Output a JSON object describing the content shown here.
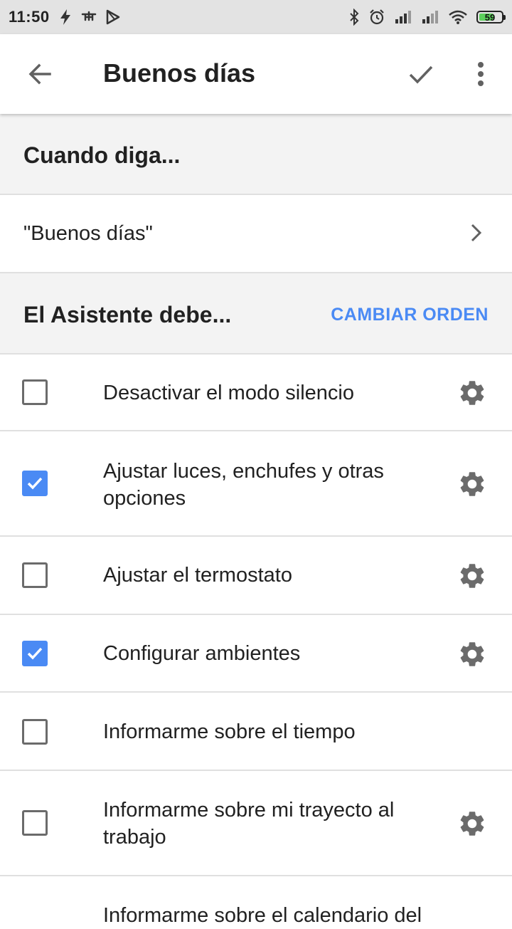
{
  "status_bar": {
    "time": "11:50",
    "battery": "59",
    "battery_color": "#5bd05b"
  },
  "app_bar": {
    "title": "Buenos días",
    "icons": [
      "back-arrow-icon",
      "check-icon",
      "more-vert-icon"
    ]
  },
  "trigger_section": {
    "title": "Cuando diga...",
    "phrase": "\"Buenos días\""
  },
  "actions_section": {
    "title": "El Asistente debe...",
    "change_order_label": "CAMBIAR ORDEN",
    "accent_color": "#4a8af4"
  },
  "tasks": [
    {
      "label": "Desactivar el modo silencio",
      "checked": false,
      "has_settings": true
    },
    {
      "label": "Ajustar luces, enchufes y otras opciones",
      "checked": true,
      "has_settings": true
    },
    {
      "label": "Ajustar el termostato",
      "checked": false,
      "has_settings": true
    },
    {
      "label": "Configurar ambientes",
      "checked": true,
      "has_settings": true
    },
    {
      "label": "Informarme sobre el tiempo",
      "checked": false,
      "has_settings": false
    },
    {
      "label": "Informarme sobre mi trayecto al trabajo",
      "checked": false,
      "has_settings": true
    },
    {
      "label": "Informarme sobre el calendario del",
      "checked": false,
      "has_settings": false
    }
  ]
}
